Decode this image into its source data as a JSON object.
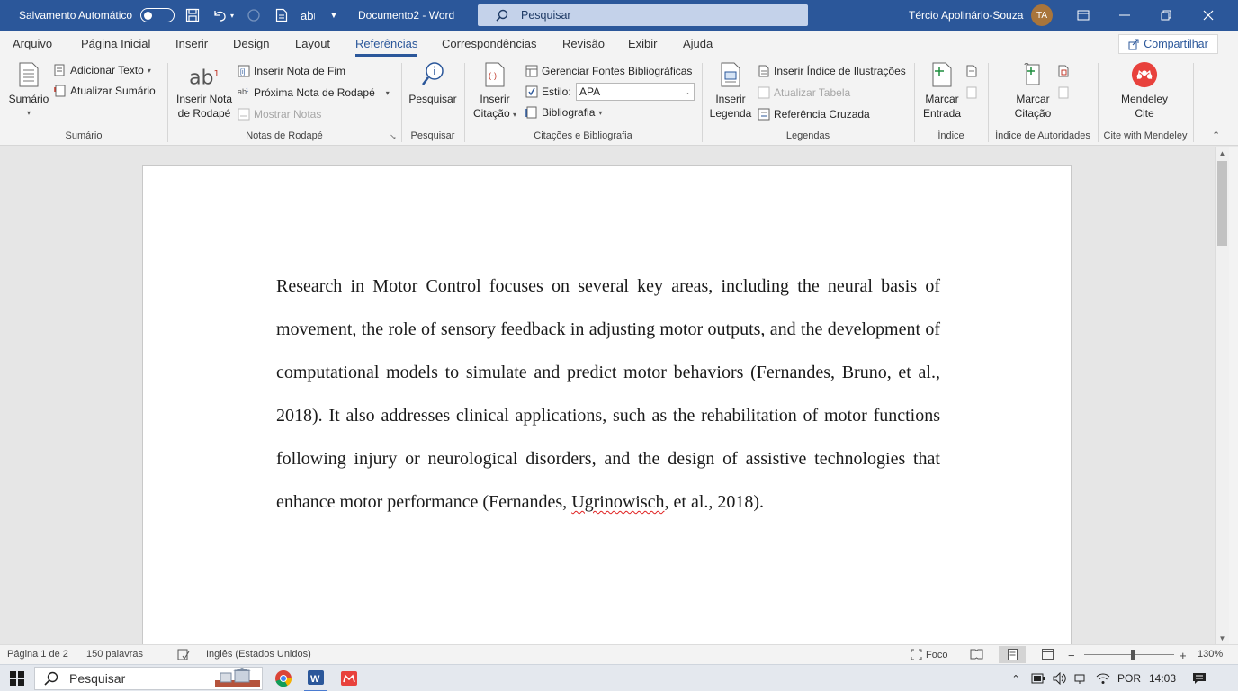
{
  "titlebar": {
    "autosave_label": "Salvamento Automático",
    "doc_title": "Documento2  -  Word",
    "search_placeholder": "Pesquisar",
    "user_name": "Tércio Apolinário-Souza",
    "user_initials": "TA",
    "accent": "#2b579a"
  },
  "tabs": [
    {
      "label": "Arquivo"
    },
    {
      "label": "Página Inicial"
    },
    {
      "label": "Inserir"
    },
    {
      "label": "Design"
    },
    {
      "label": "Layout"
    },
    {
      "label": "Referências"
    },
    {
      "label": "Correspondências"
    },
    {
      "label": "Revisão"
    },
    {
      "label": "Exibir"
    },
    {
      "label": "Ajuda"
    }
  ],
  "active_tab": "Referências",
  "share_label": "Compartilhar",
  "ribbon": {
    "sumario": {
      "big_label": "Sumário",
      "add_text": "Adicionar Texto",
      "update": "Atualizar Sumário",
      "group": "Sumário"
    },
    "notas": {
      "big_label_1": "Inserir Nota",
      "big_label_2": "de Rodapé",
      "endnote": "Inserir Nota de Fim",
      "next": "Próxima Nota de Rodapé",
      "show": "Mostrar Notas",
      "group": "Notas de Rodapé"
    },
    "pesquisar": {
      "big_label": "Pesquisar",
      "group": "Pesquisar"
    },
    "citacoes": {
      "big_label_1": "Inserir",
      "big_label_2": "Citação",
      "manage": "Gerenciar Fontes Bibliográficas",
      "style_label": "Estilo:",
      "style_value": "APA",
      "bibliography": "Bibliografia",
      "group": "Citações e Bibliografia"
    },
    "legendas": {
      "big_label_1": "Inserir",
      "big_label_2": "Legenda",
      "insert_index": "Inserir Índice de Ilustrações",
      "update_table": "Atualizar Tabela",
      "cross_ref": "Referência Cruzada",
      "group": "Legendas"
    },
    "indice": {
      "big_label_1": "Marcar",
      "big_label_2": "Entrada",
      "group": "Índice"
    },
    "autoridades": {
      "big_label_1": "Marcar",
      "big_label_2": "Citação",
      "group": "Índice de Autoridades"
    },
    "mendeley": {
      "big_label_1": "Mendeley",
      "big_label_2": "Cite",
      "group": "Cite with Mendeley",
      "brand_color": "#e8413c"
    }
  },
  "document": {
    "pre": "Research in Motor Control focuses on several key areas, including the neural basis of movement, the role of sensory feedback in adjusting motor outputs, and the development of computational models to simulate and predict motor behaviors (Fernandes, Bruno, et al., 2018).  It also addresses clinical applications, such as the rehabilitation of motor functions following injury or neurological disorders, and the design of assistive technologies that enhance motor performance (Fernandes, ",
    "misspelled": "Ugrinowisch",
    "post": ", et al., 2018)."
  },
  "statusbar": {
    "page": "Página 1 de 2",
    "words": "150 palavras",
    "language": "Inglês (Estados Unidos)",
    "focus": "Foco",
    "zoom": "130%",
    "zoom_percent": 130
  },
  "taskbar": {
    "search_label": "Pesquisar",
    "language": "POR",
    "time": "14:03"
  }
}
